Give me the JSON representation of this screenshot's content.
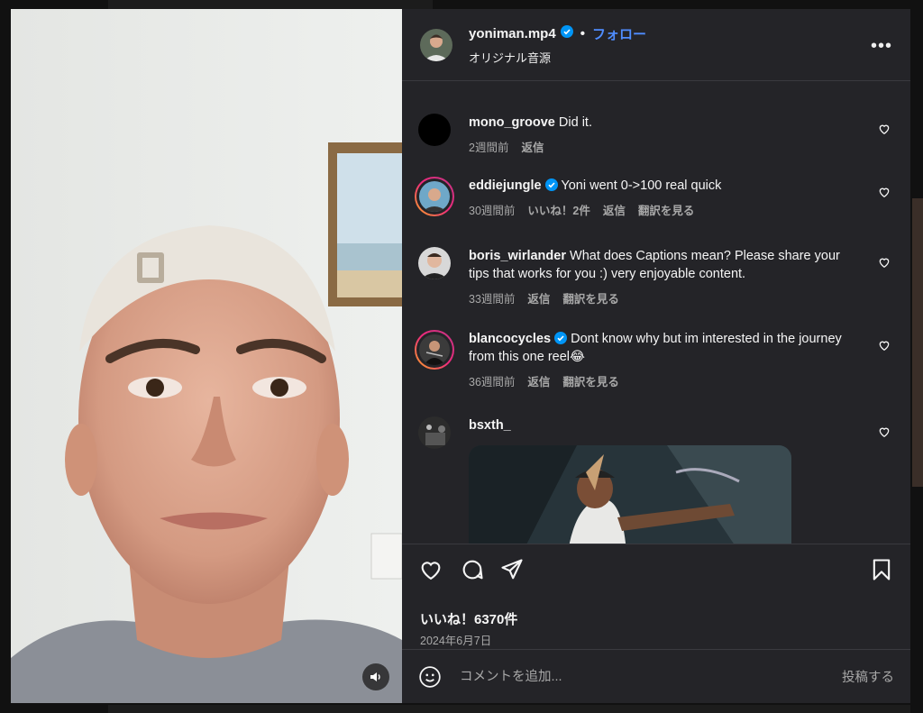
{
  "post": {
    "username": "yoniman.mp4",
    "follow_label": "フォロー",
    "audio_label": "オリジナル音源",
    "likes": "いいね！6370件",
    "date": "2024年6月7日"
  },
  "comments": [
    {
      "user": "mono_groove",
      "text": "Did it.",
      "time": "2週間前",
      "reply": "返信"
    },
    {
      "user": "eddiejungle",
      "text": "Yoni went 0->100 real quick",
      "time": "30週間前",
      "likes": "いいね！2件",
      "reply": "返信",
      "translate": "翻訳を見る"
    },
    {
      "user": "boris_wirlander",
      "text": "What does Captions mean? Please share your tips that works for you :) very enjoyable content.",
      "time": "33週間前",
      "reply": "返信",
      "translate": "翻訳を見る"
    },
    {
      "user": "blancocycles",
      "text": "Dont know why but im interested in the journey from this one reel😂",
      "time": "36週間前",
      "reply": "返信",
      "translate": "翻訳を見る"
    },
    {
      "user": "bsxth_",
      "text": ""
    }
  ],
  "composer": {
    "placeholder": "コメントを追加...",
    "post_label": "投稿する"
  },
  "colors": {
    "panel_bg": "#242428",
    "accent": "#4f8dff",
    "verified": "#0095f6",
    "secondary_text": "#a8a8a8"
  },
  "icons": [
    "verified-icon",
    "more-icon",
    "heart-icon",
    "comment-icon",
    "share-icon",
    "bookmark-icon",
    "emoji-icon",
    "volume-icon"
  ]
}
